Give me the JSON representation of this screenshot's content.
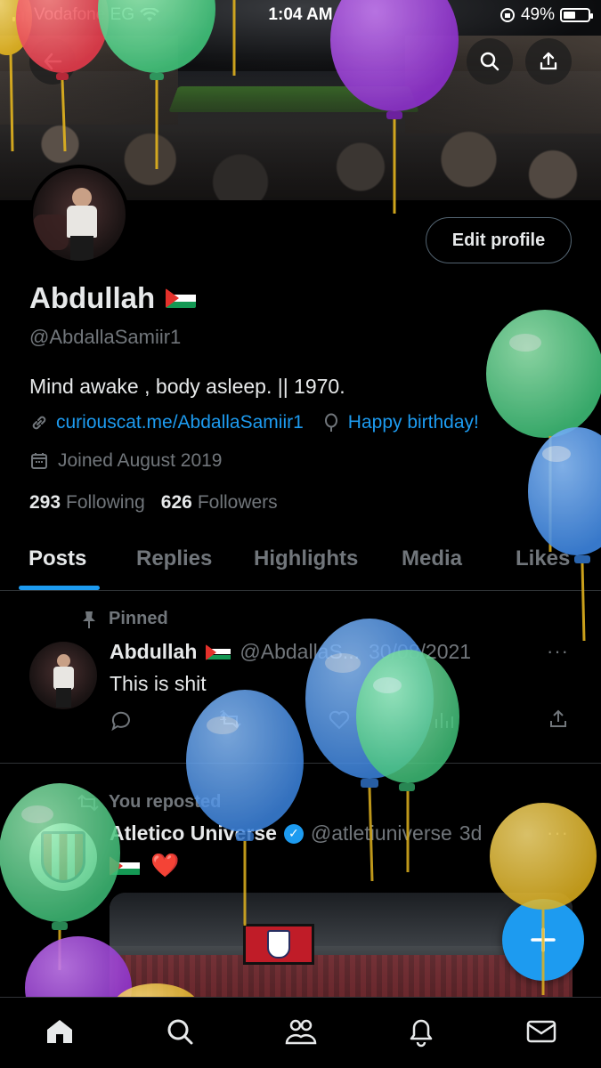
{
  "status_bar": {
    "carrier": "Vodafone EG",
    "time": "1:04 AM",
    "battery": "49%"
  },
  "header": {
    "back_icon": "back-arrow-icon",
    "search_icon": "search-icon",
    "share_icon": "share-icon"
  },
  "profile": {
    "name": "Abdullah",
    "handle": "@AbdallaSamiir1",
    "bio": "Mind awake , body asleep. || 1970.",
    "link": "curiouscat.me/AbdallaSamiir1",
    "birthday": "Happy birthday!",
    "joined": "Joined August 2019",
    "following_count": "293",
    "following_label": "Following",
    "followers_count": "626",
    "followers_label": "Followers",
    "edit_button": "Edit profile"
  },
  "tabs": [
    {
      "label": "Posts",
      "active": true
    },
    {
      "label": "Replies",
      "active": false
    },
    {
      "label": "Highlights",
      "active": false
    },
    {
      "label": "Media",
      "active": false
    },
    {
      "label": "Likes",
      "active": false
    }
  ],
  "posts": [
    {
      "pinned_label": "Pinned",
      "author": "Abdullah",
      "handle": "@AbdallaS...",
      "date": "30/08/2021",
      "text": "This is shit",
      "repost_count": "1"
    },
    {
      "repost_label": "You reposted",
      "author": "Atletico Universe",
      "handle": "@atletiuniverse",
      "date": "3d",
      "text_emoji": "❤️"
    }
  ],
  "colors": {
    "accent": "#1d9bf0",
    "background": "#000000",
    "secondary_text": "#71767b"
  },
  "nav": {
    "items": [
      "home-icon",
      "search-icon",
      "communities-icon",
      "notifications-icon",
      "messages-icon"
    ]
  }
}
